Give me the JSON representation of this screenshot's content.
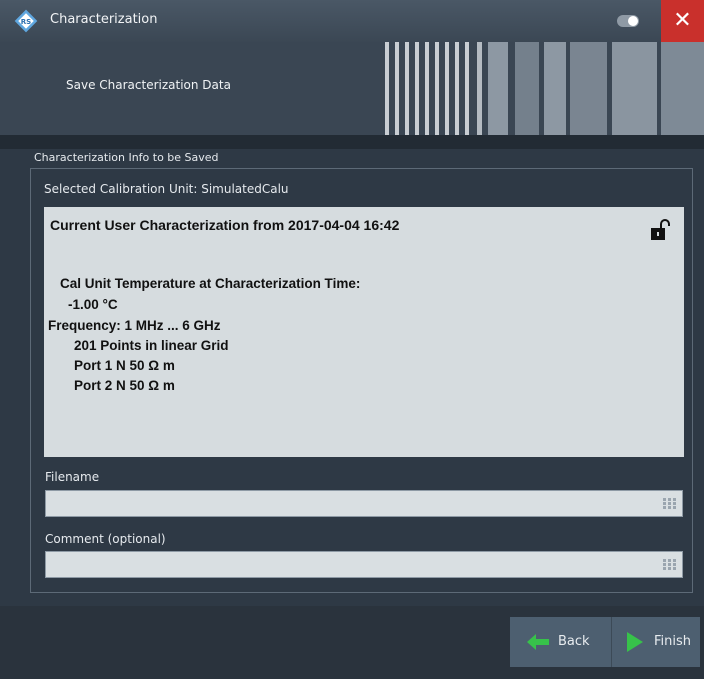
{
  "window": {
    "title": "Characterization"
  },
  "banner": {
    "title": "Save Characterization Data"
  },
  "group": {
    "label": "Characterization Info to be Saved"
  },
  "selected_unit": "Selected Calibration Unit: SimulatedCalu",
  "info": {
    "heading": "Current User Characterization from 2017-04-04 16:42",
    "lines": [
      "Cal Unit Temperature at Characterization Time:",
      "-1.00 °C",
      "Frequency: 1 MHz ... 6 GHz",
      "201 Points in linear Grid",
      "Port 1 N 50 Ω m",
      "Port 2 N 50 Ω m"
    ]
  },
  "filename": {
    "label": "Filename",
    "value": ""
  },
  "comment": {
    "label": "Comment (optional)",
    "value": ""
  },
  "buttons": {
    "back": "Back",
    "finish": "Finish"
  },
  "colors": {
    "accent_close": "#c9302c",
    "finish_arrow": "#37c24a",
    "back_arrow": "#37c24a"
  }
}
